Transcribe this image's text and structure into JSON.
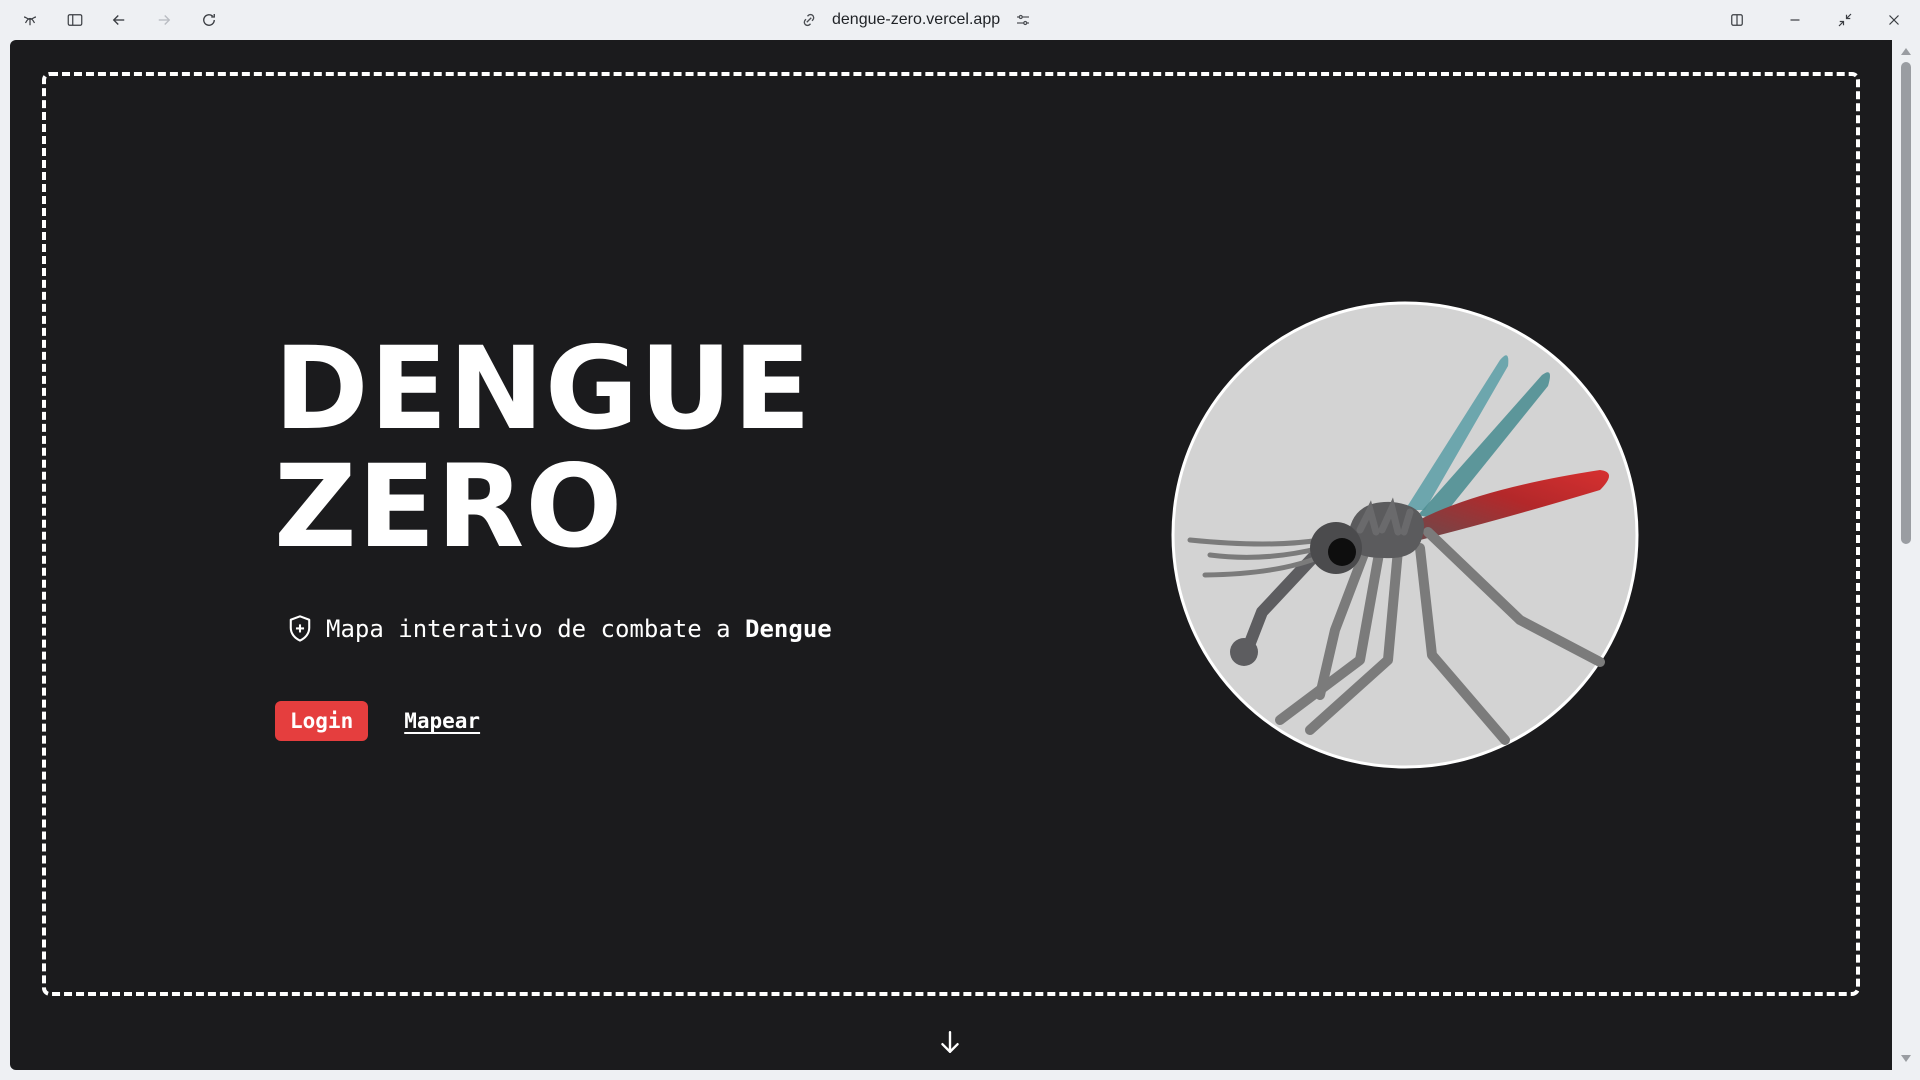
{
  "browser": {
    "url": "dengue-zero.vercel.app",
    "icons": {
      "app": "browser-logo-icon",
      "sidebar": "sidebar-toggle-icon",
      "back": "back-arrow-icon",
      "forward": "forward-arrow-icon",
      "reload": "reload-icon",
      "link": "link-icon",
      "site_settings": "sliders-icon",
      "split_view": "split-view-icon",
      "minimize": "minimize-icon",
      "restore": "restore-icon",
      "close": "close-icon"
    }
  },
  "hero": {
    "title_line1": "DENGUE",
    "title_line2": "ZERO",
    "subtitle_prefix": "Mapa interativo de combate a",
    "subtitle_bold": "Dengue",
    "subtitle_icon": "shield-plus-icon",
    "login_label": "Login",
    "map_label": "Mapear",
    "illustration": "mosquito-illustration",
    "scroll_icon": "arrow-down-icon"
  },
  "colors": {
    "background": "#1b1b1d",
    "accent": "#e53e3e",
    "text": "#ffffff"
  }
}
